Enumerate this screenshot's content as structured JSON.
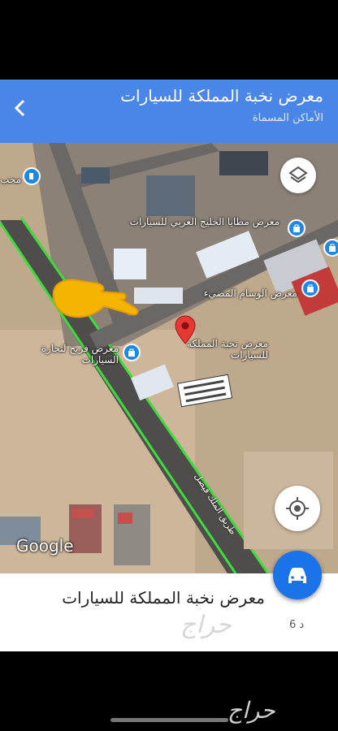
{
  "header": {
    "title": "معرض نخبة المملكة للسيارات",
    "subtitle": "الأماكن المسماة"
  },
  "map": {
    "labels": [
      {
        "key": "gulf",
        "text": "معرض مطايا الخليج العربي للسيارات"
      },
      {
        "key": "wisam",
        "text": "معرض الوسام المضيء"
      },
      {
        "key": "nokhba",
        "text": "معرض نخبة المملكة للسيارات"
      },
      {
        "key": "fraih",
        "text": "معرض فريح لتجارة السيارات"
      },
      {
        "key": "edge",
        "text": "محب"
      }
    ],
    "road_label": "طريق الملك فيصل",
    "google_logo": "Google"
  },
  "bottom_sheet": {
    "place_name": "معرض نخبة المملكة للسيارات",
    "count": "6 د",
    "watermark": "حراج"
  },
  "footer": {
    "watermark": "حراج"
  },
  "colors": {
    "header": "#4a86e8",
    "accent": "#1a73e8",
    "route": "#3ddc3d",
    "pin": "#e53935"
  },
  "icons": [
    "back-arrow-icon",
    "layers-icon",
    "my-location-icon",
    "car-icon",
    "map-pin-icon",
    "shopping-bag-icon",
    "pointing-hand-icon"
  ]
}
